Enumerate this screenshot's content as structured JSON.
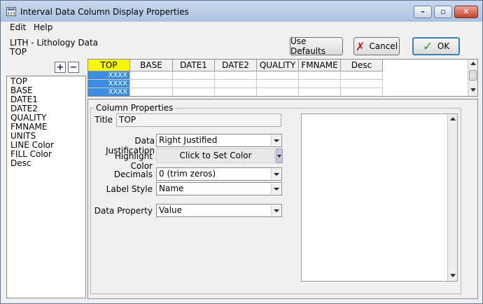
{
  "window": {
    "title": "Interval Data Column Display Properties",
    "minimize_glyph": "–",
    "maximize_glyph": "▫",
    "close_glyph": "✕"
  },
  "menu": {
    "items": [
      "Edit",
      "Help"
    ]
  },
  "header": {
    "line1": "LITH - Lithology Data",
    "line2": "TOP"
  },
  "buttons": {
    "use_defaults": "Use Defaults",
    "cancel": "Cancel",
    "ok": "OK"
  },
  "column_list": {
    "add_glyph": "+",
    "remove_glyph": "−",
    "items": [
      "TOP",
      "BASE",
      "DATE1",
      "DATE2",
      "QUALITY",
      "FMNAME",
      "UNITS",
      "LINE Color",
      "FILL Color",
      "Desc"
    ]
  },
  "grid": {
    "columns": [
      "TOP",
      "BASE",
      "DATE1",
      "DATE2",
      "QUALITY",
      "FMNAME",
      "Desc"
    ],
    "rows": [
      [
        "XXXX",
        "",
        "",
        "",
        "",
        "",
        ""
      ],
      [
        "XXXX",
        "",
        "",
        "",
        "",
        "",
        ""
      ],
      [
        "XXXX",
        "",
        "",
        "",
        "",
        "",
        ""
      ]
    ],
    "selected_color": "#f7f700",
    "first_col_color": "#3c8ce0"
  },
  "column_properties": {
    "group_label": "Column Properties",
    "title_label": "Title",
    "title_value": "TOP",
    "justification_label": "Data Justification",
    "justification_value": "Right Justified",
    "highlight_label": "Highlight Color",
    "highlight_button": "Click to Set Color",
    "decimals_label": "Decimals",
    "decimals_value": "0 (trim zeros)",
    "label_style_label": "Label Style",
    "label_style_value": "Name",
    "data_property_label": "Data Property",
    "data_property_value": "Value"
  }
}
